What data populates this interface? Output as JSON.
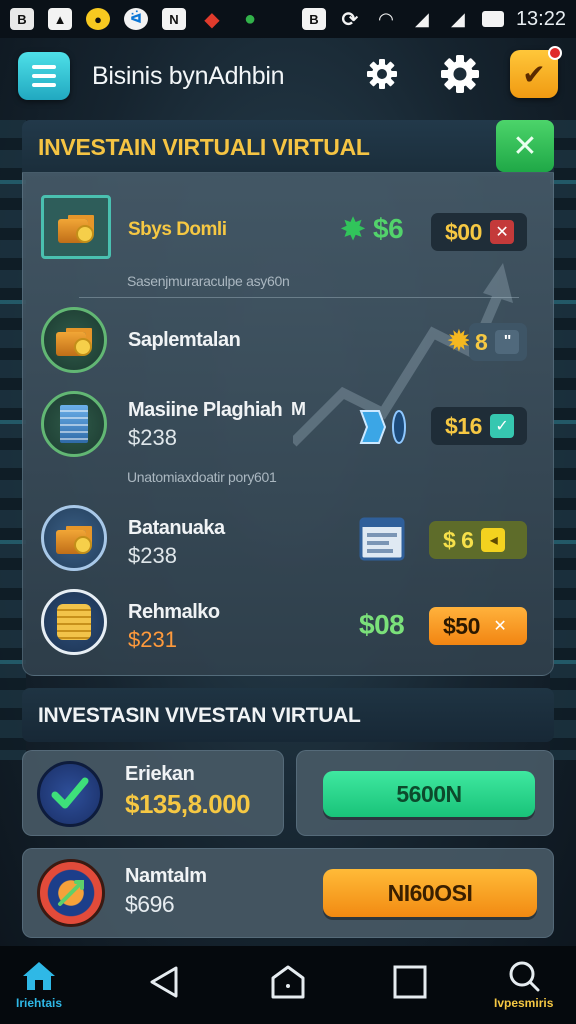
{
  "status_bar": {
    "time": "13:22",
    "icons": [
      "b-icon",
      "image-icon",
      "coin-icon",
      "bird-icon",
      "n-icon",
      "gem-icon",
      "leaf-icon",
      "bag-icon",
      "sync-icon",
      "wifi-icon",
      "signal-icon",
      "battery-icon"
    ]
  },
  "header": {
    "title": "Bisinis bynAdhbin",
    "menu_icon": "hamburger-icon",
    "settings_icon_1": "gear-icon",
    "settings_icon_2": "gear-icon",
    "notifications_icon": "check-badge-icon"
  },
  "investment_card": {
    "title": "INVESTAIN VIRTUALI VIRTUAL",
    "close_label": "✕",
    "rows": [
      {
        "name": "Sbys Domli",
        "price": "",
        "mid_text": "$6",
        "button_label": "$00",
        "button_icon": "✕"
      },
      {
        "name": "Saplemtalan",
        "price": "",
        "mid_text": "8",
        "button_label": "",
        "button_icon": "\""
      },
      {
        "name": "Masiine Plaghiah",
        "price": "$238",
        "extra": "M",
        "mid_text": "",
        "button_label": "$16",
        "button_icon": "✓"
      },
      {
        "name": "Batanuaka",
        "price": "$238",
        "mid_text": "",
        "button_label": "$ 6",
        "button_icon": "◂"
      },
      {
        "name": "Rehmalko",
        "price": "$231",
        "mid_text": "$08",
        "button_label": "$50",
        "button_icon": "✕"
      }
    ],
    "divider_1": "Sasenjmuraraculpe asy60n",
    "divider_2": "Unatomiaxdoatir pory601"
  },
  "section2": {
    "title": "INVESTASIN VIVESTAN VIRTUAL",
    "panels": [
      {
        "name": "Eriekan",
        "value": "$135,8.000",
        "button_label": "5600N"
      },
      {
        "name": "Namtalm",
        "value": "$696",
        "button_label": "NI60OSI"
      }
    ]
  },
  "nav": {
    "home_label": "Iriehtais",
    "search_label": "Ivpesmiris",
    "icons": [
      "home-icon",
      "back-icon",
      "home-outline-icon",
      "recents-icon",
      "search-icon"
    ]
  },
  "colors": {
    "accent_cyan": "#2fb8cf",
    "gold": "#f6c843",
    "green": "#2ed97a",
    "orange": "#ff9a23",
    "close_green": "#34c35a"
  }
}
